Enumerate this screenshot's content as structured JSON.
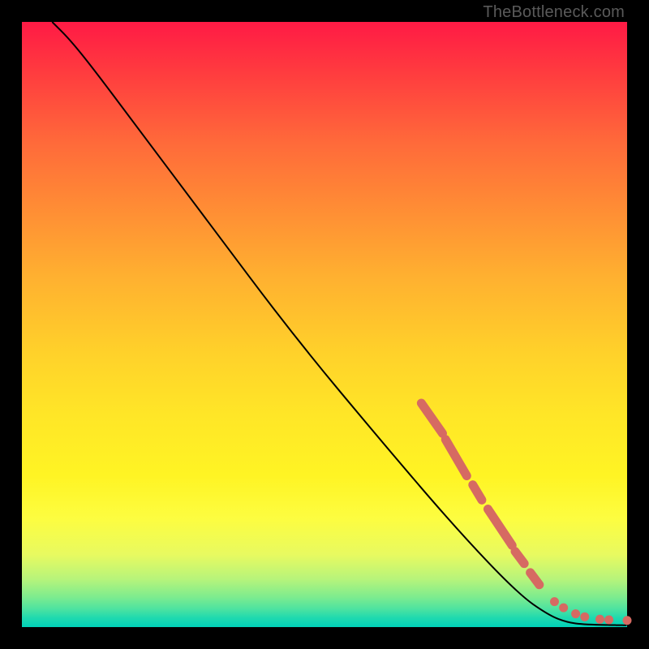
{
  "watermark": "TheBottleneck.com",
  "chart_data": {
    "type": "line",
    "title": "",
    "xlabel": "",
    "ylabel": "",
    "xlim": [
      0,
      100
    ],
    "ylim": [
      0,
      100
    ],
    "curve": {
      "name": "bottleneck-curve",
      "points": [
        {
          "x": 5,
          "y": 100
        },
        {
          "x": 8,
          "y": 97
        },
        {
          "x": 12,
          "y": 92
        },
        {
          "x": 18,
          "y": 84
        },
        {
          "x": 30,
          "y": 68
        },
        {
          "x": 45,
          "y": 48
        },
        {
          "x": 60,
          "y": 30
        },
        {
          "x": 72,
          "y": 16
        },
        {
          "x": 82,
          "y": 5.5
        },
        {
          "x": 87,
          "y": 2
        },
        {
          "x": 90,
          "y": 0.8
        },
        {
          "x": 93,
          "y": 0.4
        },
        {
          "x": 100,
          "y": 0.3
        }
      ]
    },
    "marker_segments": [
      {
        "x0": 66,
        "y0": 37,
        "x1": 69.5,
        "y1": 32
      },
      {
        "x0": 70,
        "y0": 31,
        "x1": 73.5,
        "y1": 25
      },
      {
        "x0": 74.5,
        "y0": 23.5,
        "x1": 76,
        "y1": 21
      },
      {
        "x0": 77,
        "y0": 19.5,
        "x1": 81,
        "y1": 13.5
      },
      {
        "x0": 81.5,
        "y0": 12.5,
        "x1": 83,
        "y1": 10.5
      },
      {
        "x0": 84,
        "y0": 9,
        "x1": 85.5,
        "y1": 7
      }
    ],
    "marker_dots": [
      {
        "x": 88,
        "y": 4.2
      },
      {
        "x": 89.5,
        "y": 3.2
      },
      {
        "x": 91.5,
        "y": 2.2
      },
      {
        "x": 93,
        "y": 1.7
      },
      {
        "x": 95.5,
        "y": 1.3
      },
      {
        "x": 97,
        "y": 1.2
      },
      {
        "x": 100,
        "y": 1.1
      }
    ],
    "colors": {
      "curve": "#000000",
      "marker": "#d66a62"
    }
  }
}
